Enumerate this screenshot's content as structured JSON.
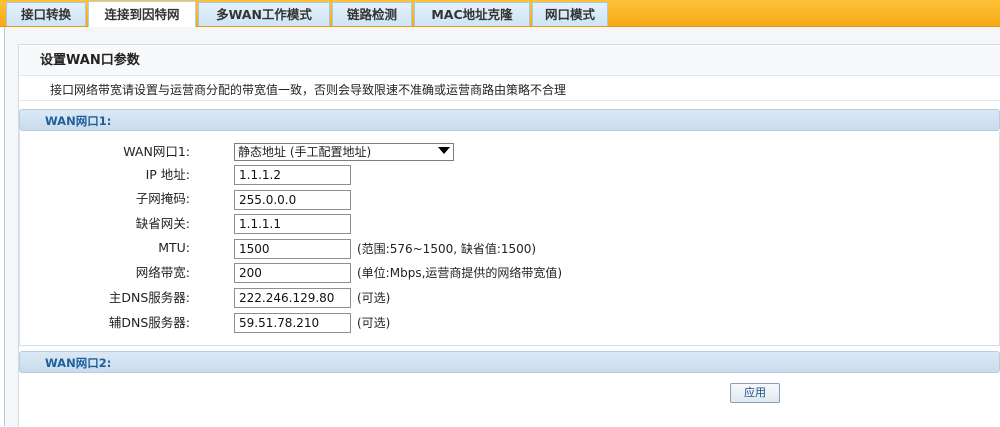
{
  "tabs": [
    {
      "label": "接口转换"
    },
    {
      "label": "连接到因特网"
    },
    {
      "label": "多WAN工作模式"
    },
    {
      "label": "链路检测"
    },
    {
      "label": "MAC地址克隆"
    },
    {
      "label": "网口模式"
    }
  ],
  "active_tab": "连接到因特网",
  "section_title": "设置WAN口参数",
  "notice": "接口网络带宽请设置与运营商分配的带宽值一致，否则会导致限速不准确或运营商路由策略不合理",
  "wan1": {
    "header": "WAN网口1:",
    "mode_label": "WAN网口1:",
    "mode_value": "静态地址 (手工配置地址)",
    "ip_label": "IP 地址:",
    "ip_value": "1.1.1.2",
    "mask_label": "子网掩码:",
    "mask_value": "255.0.0.0",
    "gateway_label": "缺省网关:",
    "gateway_value": "1.1.1.1",
    "mtu_label": "MTU:",
    "mtu_value": "1500",
    "mtu_hint": "(范围:576~1500, 缺省值:1500)",
    "bandwidth_label": "网络带宽:",
    "bandwidth_value": "200",
    "bandwidth_hint": "(单位:Mbps,运营商提供的网络带宽值)",
    "dns1_label": "主DNS服务器:",
    "dns1_value": "222.246.129.80",
    "dns1_hint": "(可选)",
    "dns2_label": "辅DNS服务器:",
    "dns2_value": "59.51.78.210",
    "dns2_hint": "(可选)"
  },
  "wan2": {
    "header": "WAN网口2:"
  },
  "apply_label": "应用",
  "colors": {
    "tabbar": "#f7a916",
    "group_header": "#c9dced",
    "group_text": "#1f5f9a"
  }
}
